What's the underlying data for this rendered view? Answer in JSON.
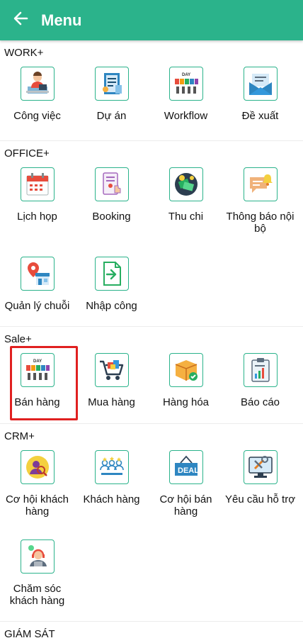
{
  "appbar": {
    "title": "Menu",
    "back_icon": "arrow-left-icon"
  },
  "sections": [
    {
      "title": "WORK+",
      "items": [
        {
          "label": "Công việc",
          "icon": "person-at-desk-icon"
        },
        {
          "label": "Dự án",
          "icon": "project-document-icon"
        },
        {
          "label": "Workflow",
          "icon": "day-workflow-icon"
        },
        {
          "label": "Đề xuất",
          "icon": "envelope-icon"
        }
      ]
    },
    {
      "title": "OFFICE+",
      "items": [
        {
          "label": "Lịch họp",
          "icon": "calendar-icon"
        },
        {
          "label": "Booking",
          "icon": "touch-booking-icon"
        },
        {
          "label": "Thu chi",
          "icon": "money-icon"
        },
        {
          "label": "Thông báo nội bộ",
          "icon": "notification-chat-icon"
        },
        {
          "label": "Quản lý chuỗi",
          "icon": "store-location-icon"
        },
        {
          "label": "Nhập công",
          "icon": "import-file-icon"
        }
      ]
    },
    {
      "title": "Sale+",
      "items": [
        {
          "label": "Bán hàng",
          "icon": "day-workflow-icon",
          "selected": true
        },
        {
          "label": "Mua hàng",
          "icon": "shopping-cart-icon"
        },
        {
          "label": "Hàng hóa",
          "icon": "package-box-icon"
        },
        {
          "label": "Báo cáo",
          "icon": "report-clipboard-icon"
        }
      ]
    },
    {
      "title": "CRM+",
      "items": [
        {
          "label": "Cơ hội khách hàng",
          "icon": "customer-search-icon"
        },
        {
          "label": "Khách hàng",
          "icon": "customers-group-icon"
        },
        {
          "label": "Cơ hội bán hàng",
          "icon": "deal-sign-icon"
        },
        {
          "label": "Yêu cầu hỗ trợ",
          "icon": "support-tools-icon"
        },
        {
          "label": "Chăm sóc khách hàng",
          "icon": "customer-care-headset-icon"
        }
      ]
    },
    {
      "title": "GIÁM SÁT",
      "items": []
    }
  ],
  "colors": {
    "appbar": "#2bb38b",
    "icon_border": "#2bb38b",
    "highlight": "#e02020"
  }
}
